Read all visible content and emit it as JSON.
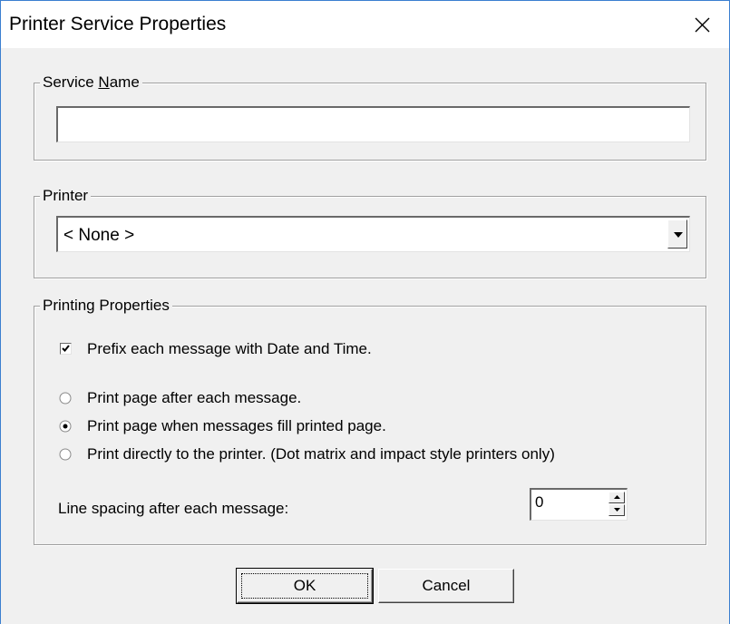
{
  "window": {
    "title": "Printer Service Properties"
  },
  "service_name": {
    "label_prefix": "Service ",
    "label_accel": "N",
    "label_suffix": "ame",
    "value": ""
  },
  "printer": {
    "label": "Printer",
    "selected": "< None >"
  },
  "printing_properties": {
    "label": "Printing Properties",
    "prefix_checkbox": {
      "label": "Prefix each message with Date and Time.",
      "checked": true
    },
    "radios": [
      {
        "label": "Print page after each message.",
        "selected": false
      },
      {
        "label": "Print page when messages fill printed page.",
        "selected": true
      },
      {
        "label": "Print directly to the printer. (Dot matrix and impact style printers only)",
        "selected": false
      }
    ],
    "line_spacing": {
      "label": "Line spacing after each message:",
      "value": "0"
    }
  },
  "buttons": {
    "ok": "OK",
    "cancel": "Cancel"
  }
}
